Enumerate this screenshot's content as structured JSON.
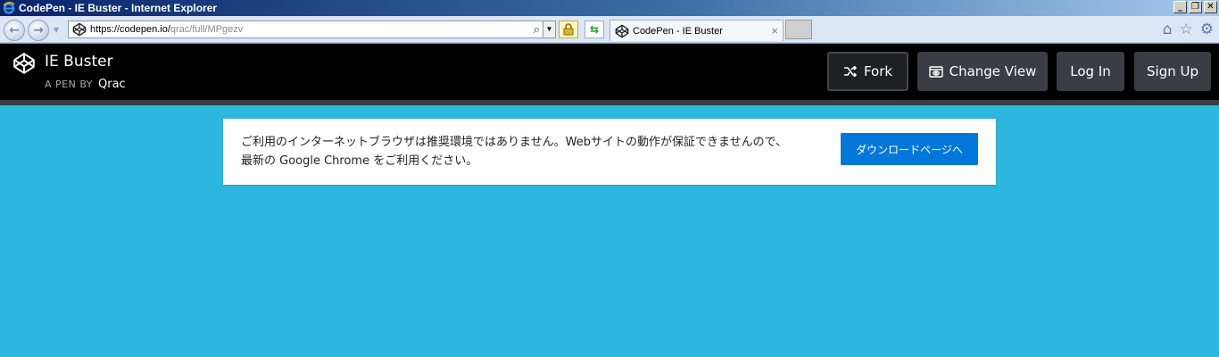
{
  "window": {
    "title": "CodePen - IE Buster - Internet Explorer",
    "minimize_glyph": "_",
    "restore_glyph": "❐",
    "close_glyph": "✕"
  },
  "browser": {
    "url_host": "https://codepen.io/",
    "url_path": "qrac/full/MPgezv",
    "tab_title": "CodePen - IE Buster",
    "tab_close": "×",
    "back_glyph": "←",
    "forward_glyph": "→",
    "home_icon": "⌂",
    "favorites_icon": "☆",
    "tools_icon": "⚙"
  },
  "pen": {
    "title": "IE Buster",
    "author_prefix": "A PEN BY",
    "author": "Qrac"
  },
  "header_buttons": {
    "fork": "Fork",
    "change_view": "Change View",
    "login": "Log In",
    "signup": "Sign Up"
  },
  "buster": {
    "message_line1": "ご利用のインターネットブラウザは推奨環境ではありません。Webサイトの動作が保証できませんので、",
    "message_line2": "最新の Google Chrome をご利用ください。",
    "button": "ダウンロードページへ"
  },
  "colors": {
    "page_background": "#2eb7de",
    "header_background": "#000000",
    "header_button": "#3b3d45",
    "buster_button": "#0077d9"
  }
}
